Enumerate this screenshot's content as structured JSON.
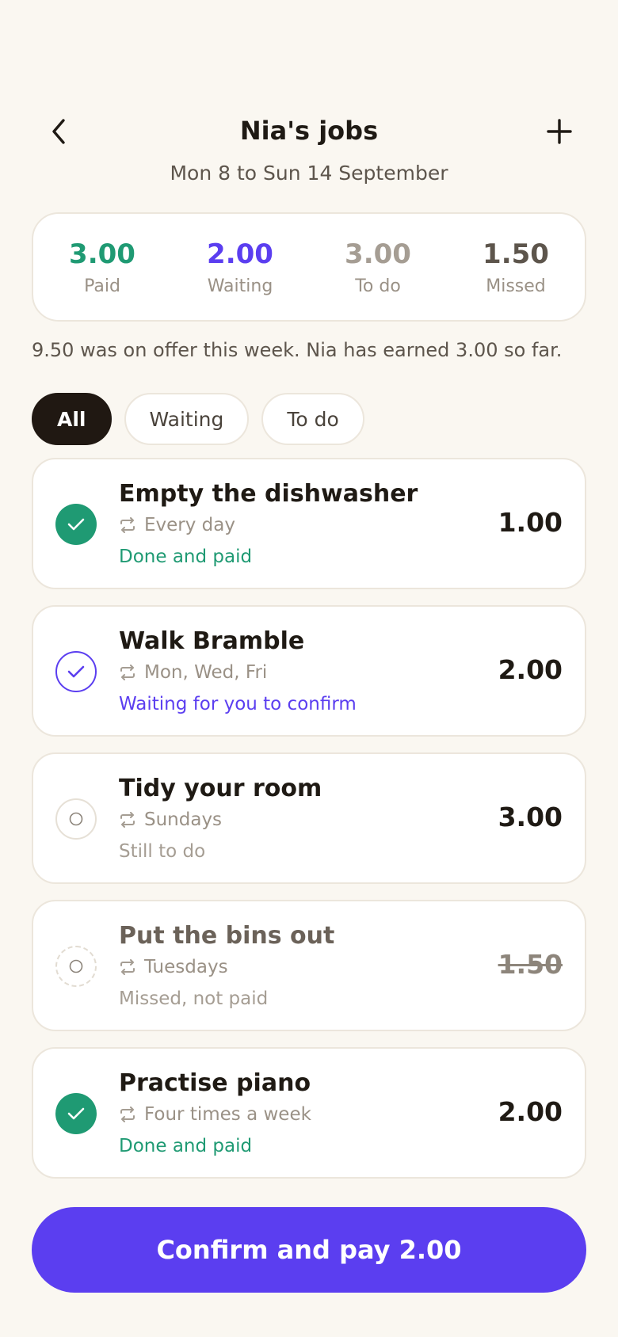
{
  "header": {
    "title": "Nia's jobs",
    "date_range": "Mon 8 to Sun 14 September"
  },
  "summary": [
    {
      "value": "3.00",
      "label": "Paid",
      "color": "#1f9a73"
    },
    {
      "value": "2.00",
      "label": "Waiting",
      "color": "#5b3ef0"
    },
    {
      "value": "3.00",
      "label": "To do",
      "color": "#a59d93"
    },
    {
      "value": "1.50",
      "label": "Missed",
      "color": "#5d554c"
    }
  ],
  "note": "9.50 was on offer this week. Nia has earned 3.00 so far.",
  "filters": [
    {
      "label": "All",
      "active": true
    },
    {
      "label": "Waiting",
      "active": false
    },
    {
      "label": "To do",
      "active": false
    }
  ],
  "jobs": [
    {
      "name": "Empty the dishwasher",
      "frequency": "Every day",
      "status": "Done and paid",
      "amount": "1.00",
      "state": "paid"
    },
    {
      "name": "Walk Bramble",
      "frequency": "Mon, Wed, Fri",
      "status": "Waiting for you to confirm",
      "amount": "2.00",
      "state": "waiting"
    },
    {
      "name": "Tidy your room",
      "frequency": "Sundays",
      "status": "Still to do",
      "amount": "3.00",
      "state": "todo"
    },
    {
      "name": "Put the bins out",
      "frequency": "Tuesdays",
      "status": "Missed, not paid",
      "amount": "1.50",
      "state": "missed"
    },
    {
      "name": "Practise piano",
      "frequency": "Four times a week",
      "status": "Done and paid",
      "amount": "2.00",
      "state": "paid"
    }
  ],
  "cta_label": "Confirm and pay 2.00",
  "colors": {
    "paid": "#1f9a73",
    "waiting": "#5b3ef0",
    "todo_text": "#a59d93",
    "missed_text": "#8d857b",
    "background": "#faf7f1"
  },
  "icons": {
    "back": "chevron-left-icon",
    "add": "plus-icon",
    "repeat": "repeat-icon",
    "check": "check-icon"
  }
}
